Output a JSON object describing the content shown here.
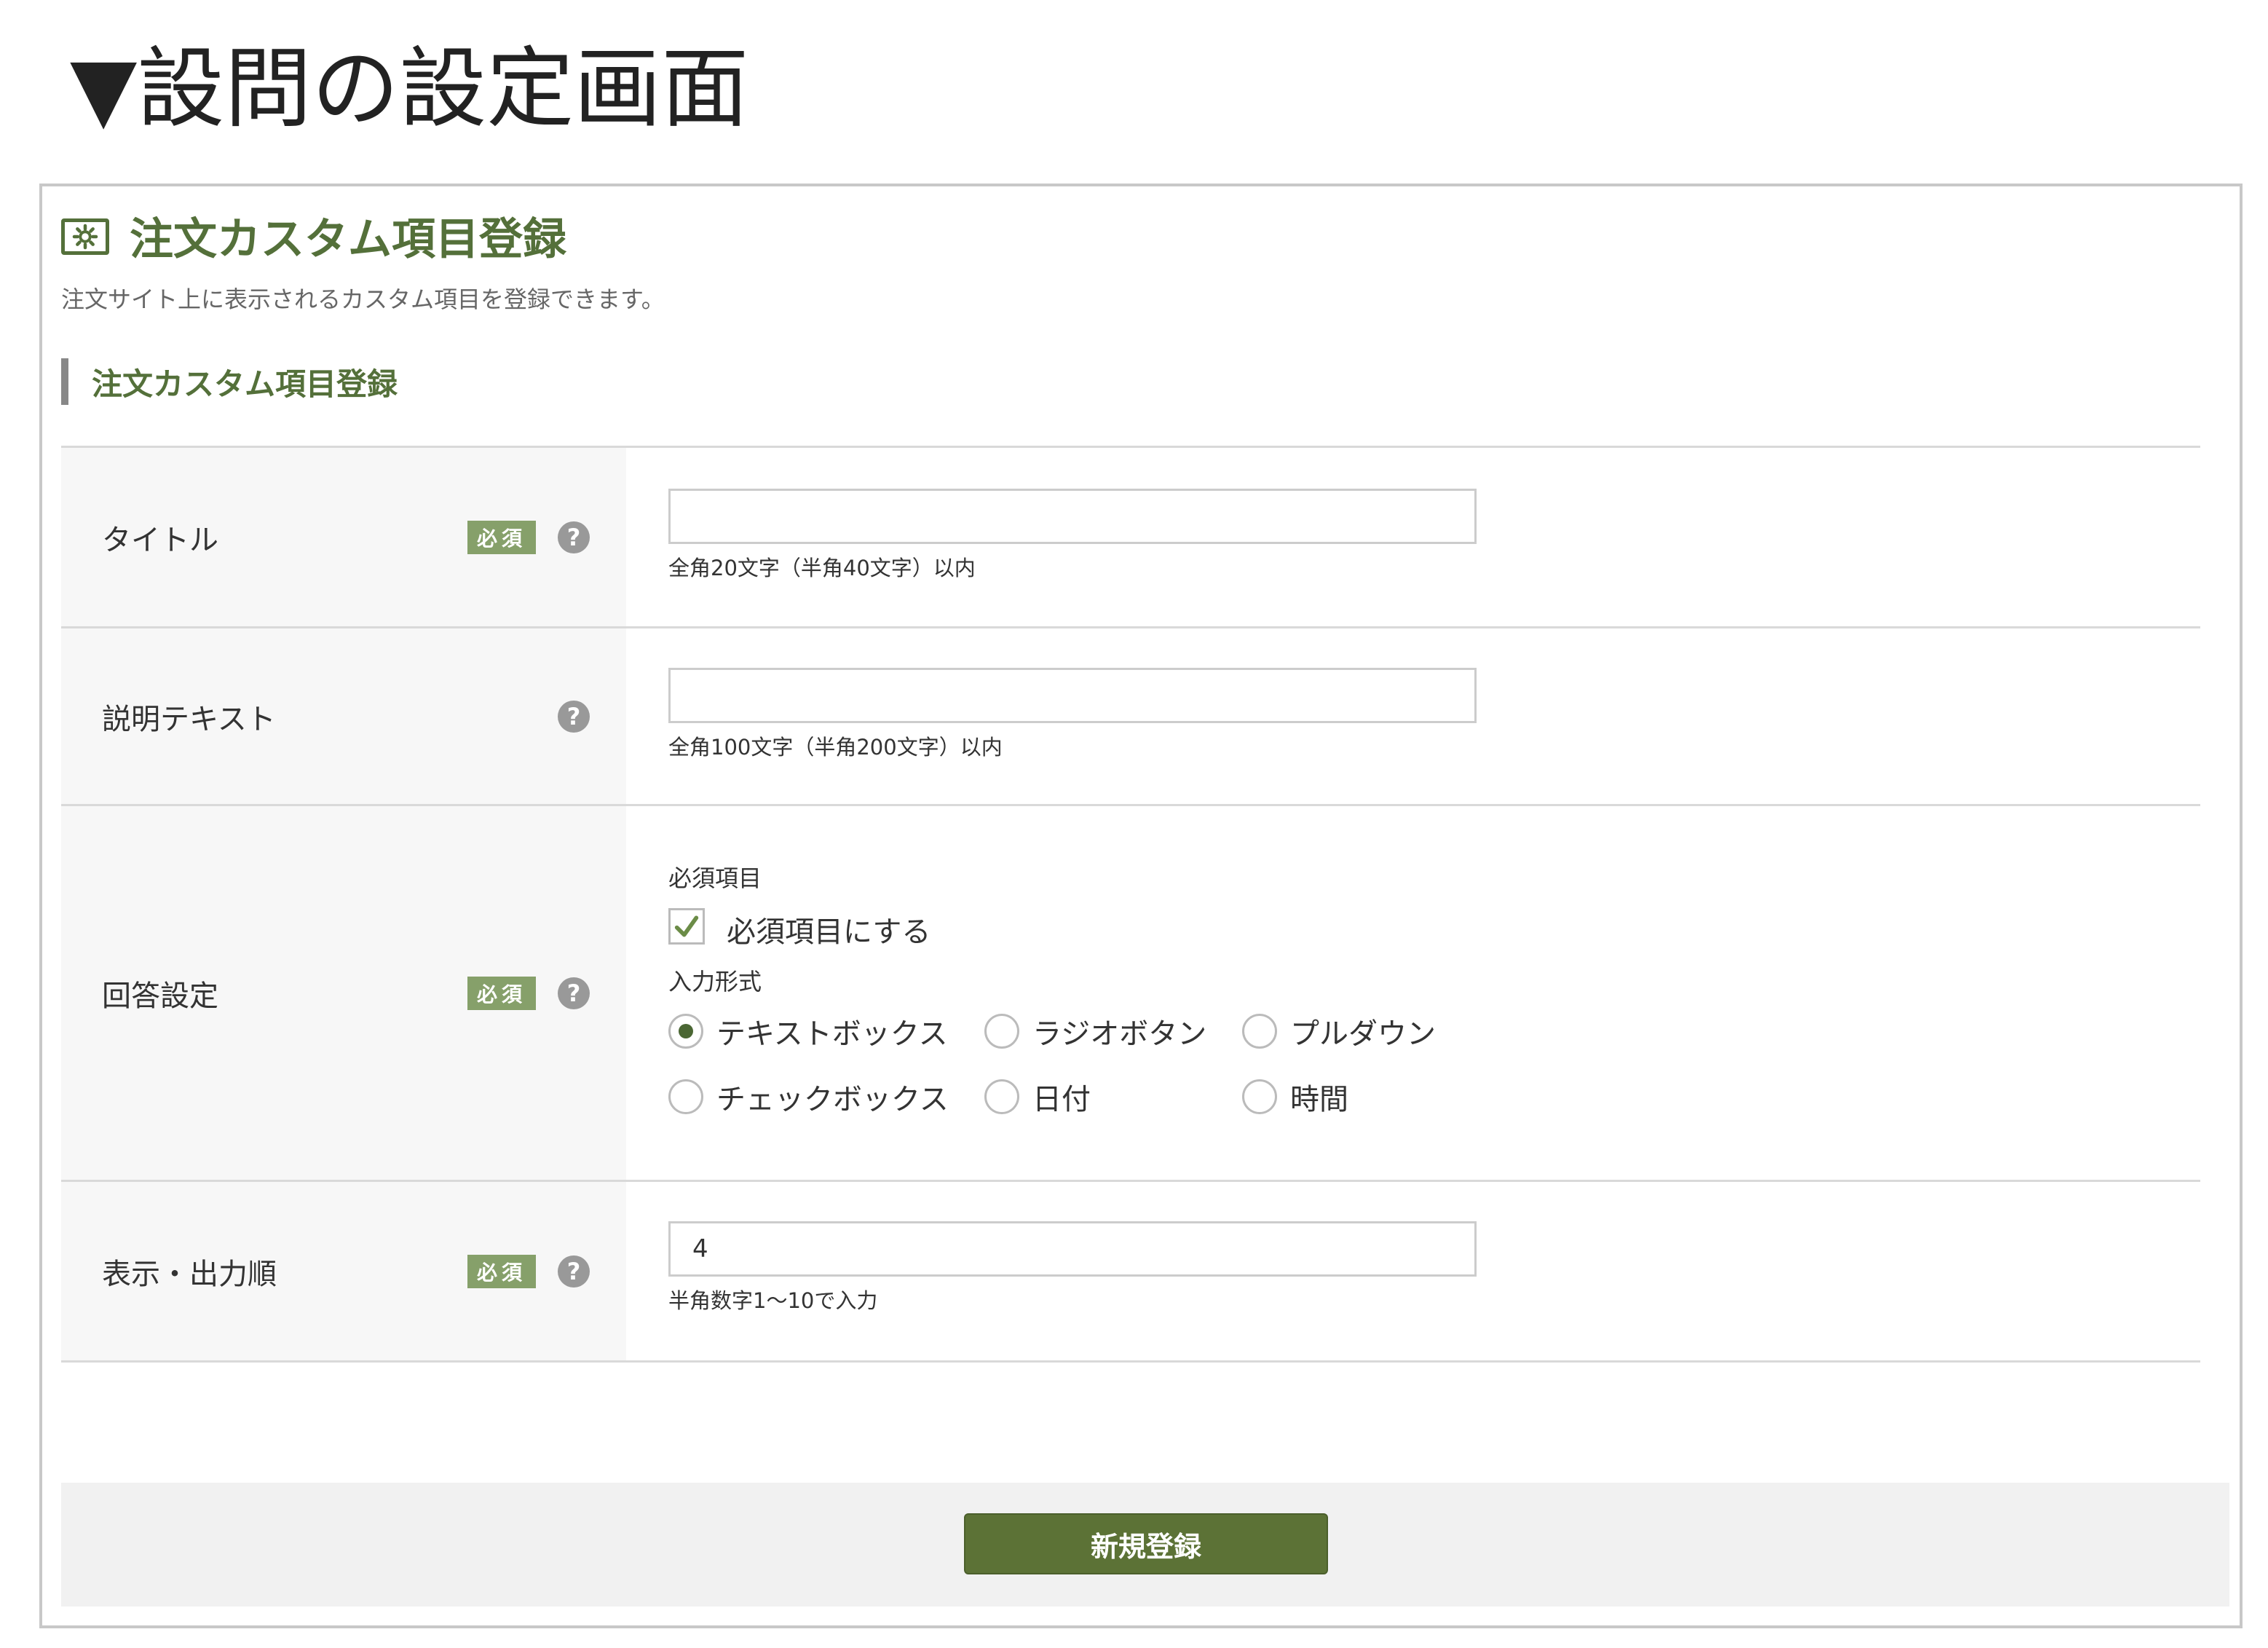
{
  "caption": "▼設問の設定画面",
  "panel": {
    "title": "注文カスタム項目登録",
    "description": "注文サイト上に表示されるカスタム項目を登録できます。",
    "section_title": "注文カスタム項目登録",
    "icon": "gear-icon"
  },
  "required_badge": "必須",
  "help_glyph": "?",
  "rows": {
    "title": {
      "label": "タイトル",
      "required": true,
      "value": "",
      "hint": "全角20文字（半角40文字）以内"
    },
    "description": {
      "label": "説明テキスト",
      "required": false,
      "value": "",
      "hint": "全角100文字（半角200文字）以内"
    },
    "answer": {
      "label": "回答設定",
      "required": true,
      "required_heading": "必須項目",
      "required_checkbox_label": "必須項目にする",
      "required_checked": true,
      "format_heading": "入力形式",
      "selected_format": "テキストボックス",
      "formats": [
        "テキストボックス",
        "ラジオボタン",
        "プルダウン",
        "チェックボックス",
        "日付",
        "時間"
      ]
    },
    "order": {
      "label": "表示・出力順",
      "required": true,
      "value": "4",
      "hint": "半角数字1～10で入力"
    }
  },
  "submit_label": "新規登録",
  "colors": {
    "brand_green": "#54703a",
    "badge_green": "#86a06a",
    "button_green": "#5c7236"
  }
}
